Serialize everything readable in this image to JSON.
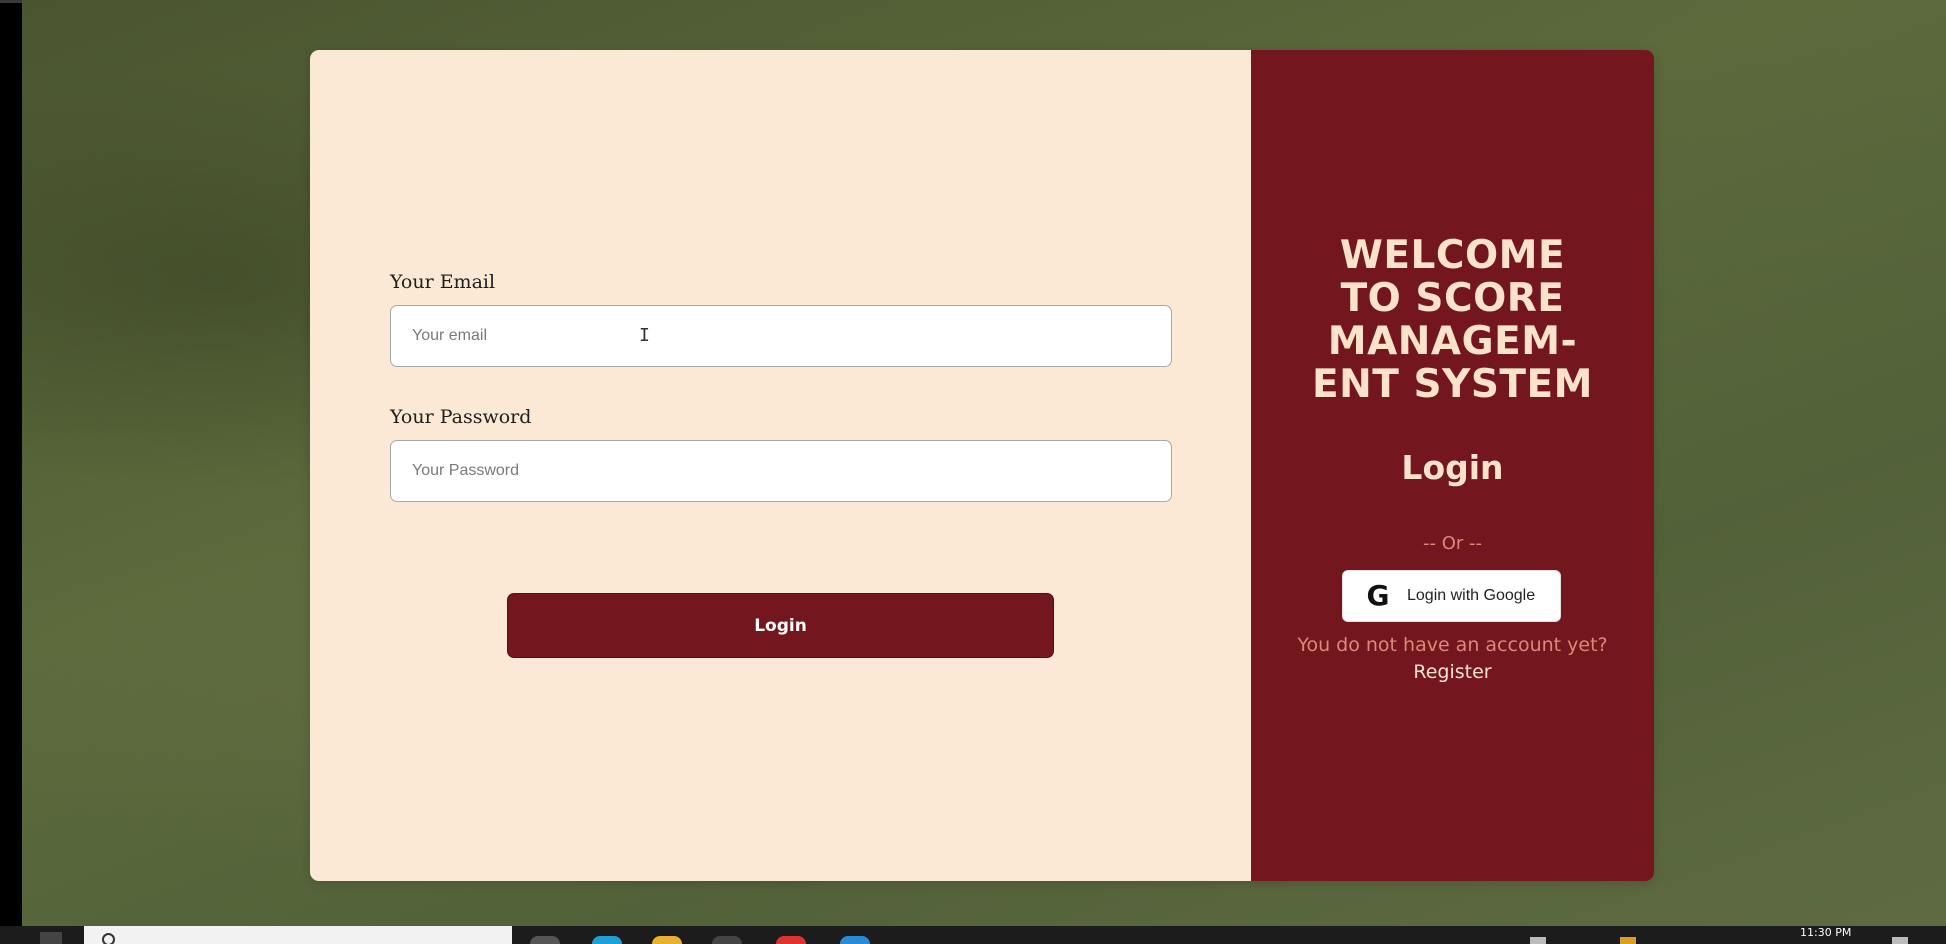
{
  "form": {
    "email_label": "Your Email",
    "email_placeholder": "Your email",
    "password_label": "Your Password",
    "password_placeholder": "Your Password",
    "login_button": "Login"
  },
  "side": {
    "welcome_lines": [
      "WELCOME",
      "TO SCORE",
      "MANAGEM-",
      "ENT SYSTEM"
    ],
    "title": "Login",
    "or_text": "-- Or --",
    "google_icon": "G",
    "google_button": "Login with Google",
    "no_account_text": "You do not have an account yet?",
    "register_link": "Register"
  },
  "taskbar": {
    "clock": "11:30 PM"
  },
  "icons": [
    "text-cursor-icon",
    "google-icon",
    "search-icon",
    "windows-start-icon"
  ],
  "colors": {
    "accent": "#73161e",
    "form_background": "#fbe9d5",
    "welcome_text": "#fbe2cb",
    "muted_text": "#d98a78"
  }
}
